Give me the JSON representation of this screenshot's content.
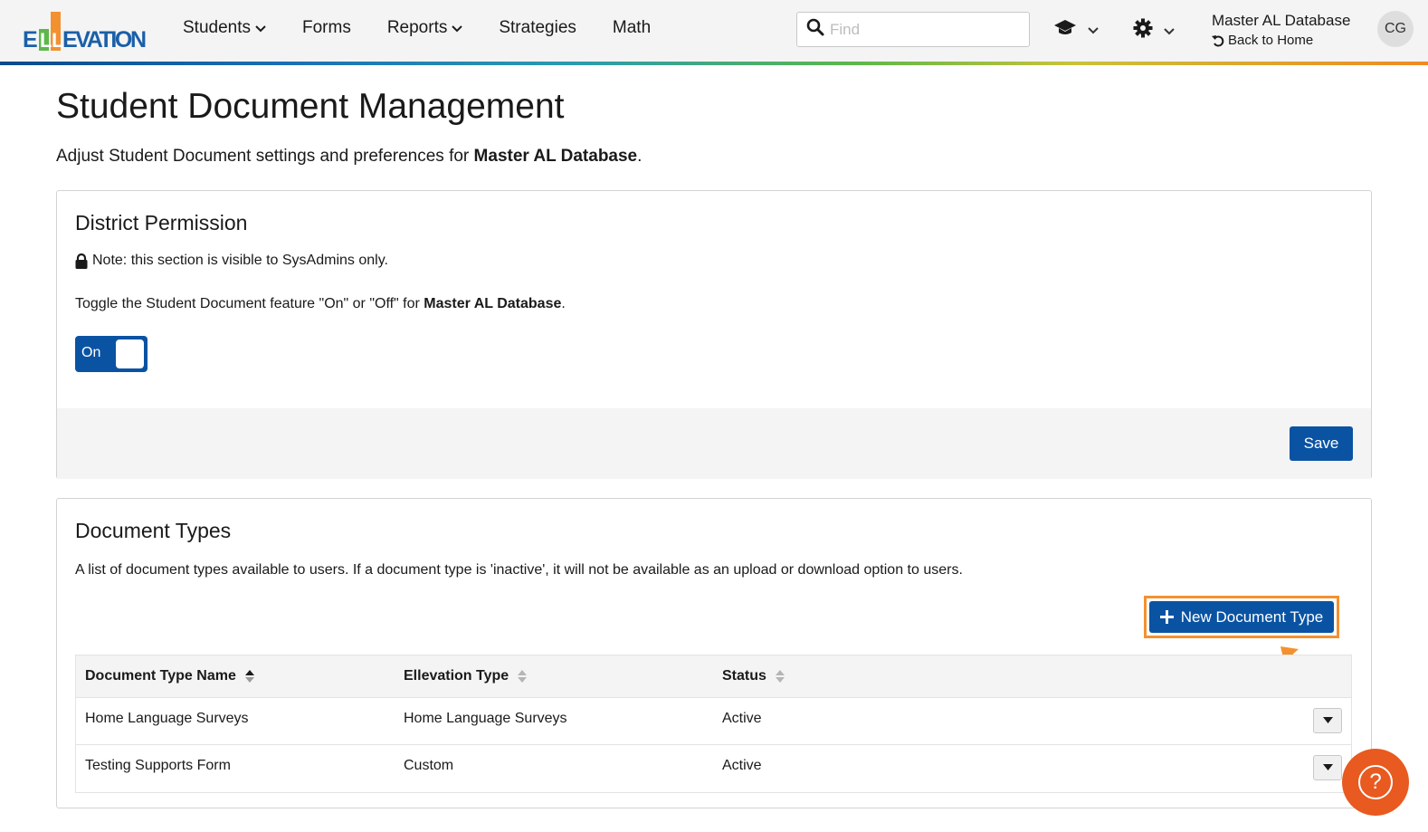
{
  "header": {
    "logo_text": "ELLEVATION",
    "nav": [
      {
        "label": "Students",
        "has_dropdown": true
      },
      {
        "label": "Forms",
        "has_dropdown": false
      },
      {
        "label": "Reports",
        "has_dropdown": true
      },
      {
        "label": "Strategies",
        "has_dropdown": false
      },
      {
        "label": "Math",
        "has_dropdown": false
      }
    ],
    "search": {
      "placeholder": "Find",
      "value": ""
    },
    "user": {
      "database": "Master AL Database",
      "back_link": "Back to Home",
      "initials": "CG"
    }
  },
  "page": {
    "title": "Student Document Management",
    "subtitle_prefix": "Adjust Student Document settings and preferences for ",
    "subtitle_db": "Master AL Database",
    "subtitle_suffix": "."
  },
  "district_permission": {
    "title": "District Permission",
    "note": "Note: this section is visible to SysAdmins only.",
    "toggle_prefix": "Toggle the Student Document feature \"On\" or \"Off\" for ",
    "toggle_db": "Master AL Database",
    "toggle_suffix": ".",
    "toggle_label": "On",
    "toggle_state": true,
    "save_label": "Save"
  },
  "document_types": {
    "title": "Document Types",
    "description": "A list of document types available to users. If a document type is 'inactive', it will not be available as an upload or download option to users.",
    "new_button_label": "New Document Type",
    "columns": [
      "Document Type Name",
      "Ellevation Type",
      "Status"
    ],
    "rows": [
      {
        "name": "Home Language Surveys",
        "type": "Home Language Surveys",
        "status": "Active"
      },
      {
        "name": "Testing Supports Form",
        "type": "Custom",
        "status": "Active"
      }
    ]
  },
  "colors": {
    "primary": "#0a53a3",
    "highlight": "#f39130",
    "help": "#e85a1f"
  }
}
